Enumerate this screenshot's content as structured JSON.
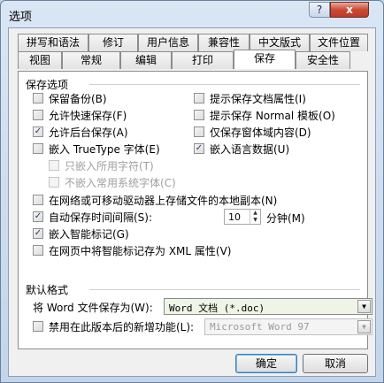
{
  "window": {
    "title": "选项",
    "help_label": "?",
    "close_label": "x"
  },
  "tabs_row1": [
    "拼写和语法",
    "修订",
    "用户信息",
    "兼容性",
    "中文版式",
    "文件位置"
  ],
  "tabs_row2": [
    "视图",
    "常规",
    "编辑",
    "打印",
    "保存",
    "安全性"
  ],
  "active_tab": "保存",
  "save_options": {
    "group_title": "保存选项",
    "left": [
      {
        "label": "保留备份(B)",
        "checked": false,
        "enabled": true
      },
      {
        "label": "允许快速保存(F)",
        "checked": false,
        "enabled": true
      },
      {
        "label": "允许后台保存(A)",
        "checked": true,
        "enabled": true
      },
      {
        "label": "嵌入 TrueType 字体(E)",
        "checked": false,
        "enabled": true
      },
      {
        "label": "只嵌入所用字符(T)",
        "checked": false,
        "enabled": false
      },
      {
        "label": "不嵌入常用系统字体(C)",
        "checked": false,
        "enabled": false
      }
    ],
    "right": [
      {
        "label": "提示保存文档属性(I)",
        "checked": false
      },
      {
        "label": "提示保存 Normal 模板(O)",
        "checked": false
      },
      {
        "label": "仅保存窗体域内容(D)",
        "checked": false
      },
      {
        "label": "嵌入语言数据(U)",
        "checked": true
      }
    ],
    "network_copy": {
      "label": "在网络或可移动驱动器上存储文件的本地副本(N)",
      "checked": false
    },
    "autosave": {
      "label": "自动保存时间间隔(S):",
      "checked": true,
      "value": "10",
      "unit": "分钟(M)"
    },
    "smart_tags": {
      "label": "嵌入智能标记(G)",
      "checked": true
    },
    "smart_tags_xml": {
      "label": "在网页中将智能标记存为 XML 属性(V)",
      "checked": false
    }
  },
  "default_format": {
    "group_title": "默认格式",
    "save_as_label": "将 Word 文件保存为(W):",
    "save_as_value": "Word 文档 (*.doc)",
    "disable_features": {
      "label": "禁用在此版本后的新增功能(L):",
      "checked": false
    },
    "version_value": "Microsoft Word 97"
  },
  "buttons": {
    "ok": "确定",
    "cancel": "取消"
  }
}
